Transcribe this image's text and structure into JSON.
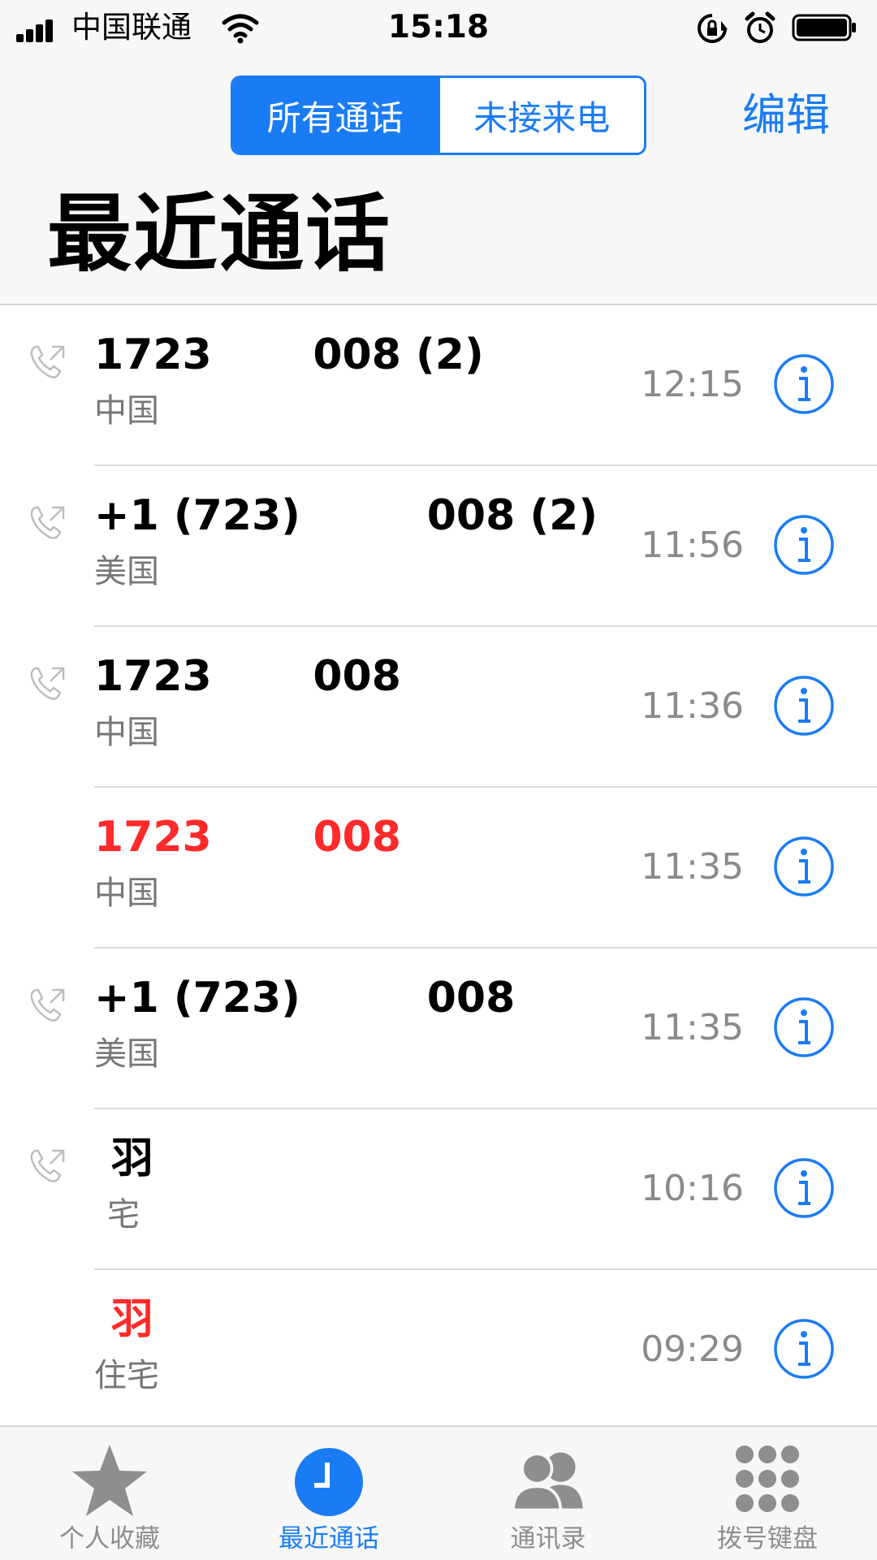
{
  "status_bar": {
    "carrier": "中国联通",
    "time": "15:18"
  },
  "header": {
    "segments": [
      "所有通话",
      "未接来电"
    ],
    "edit_label": "编辑",
    "title": "最近通话"
  },
  "calls": [
    {
      "name": "1723            008 (2)",
      "label": "中国",
      "time": "12:15",
      "missed": false
    },
    {
      "name": "+1 (723)               008 (2)",
      "label": "美国",
      "time": "11:56",
      "missed": false
    },
    {
      "name": "1723            008",
      "label": "中国",
      "time": "11:36",
      "missed": false
    },
    {
      "name": "1723            008",
      "label": "中国",
      "time": "11:35",
      "missed": true
    },
    {
      "name": "+1 (723)               008",
      "label": "美国",
      "time": "11:35",
      "missed": false
    },
    {
      "name": "  羽",
      "label": "  宅",
      "time": "10:16",
      "missed": false
    },
    {
      "name": "  羽",
      "label": "住宅",
      "time": "09:29",
      "missed": true
    }
  ],
  "tabs": [
    {
      "label": "个人收藏",
      "icon": "star-icon"
    },
    {
      "label": "最近通话",
      "icon": "clock-icon"
    },
    {
      "label": "通讯录",
      "icon": "contacts-icon"
    },
    {
      "label": "拨号键盘",
      "icon": "keypad-icon"
    }
  ],
  "colors": {
    "accent": "#1a7cf5",
    "missed": "#ff2a2a",
    "secondary": "#8a8a8a"
  }
}
